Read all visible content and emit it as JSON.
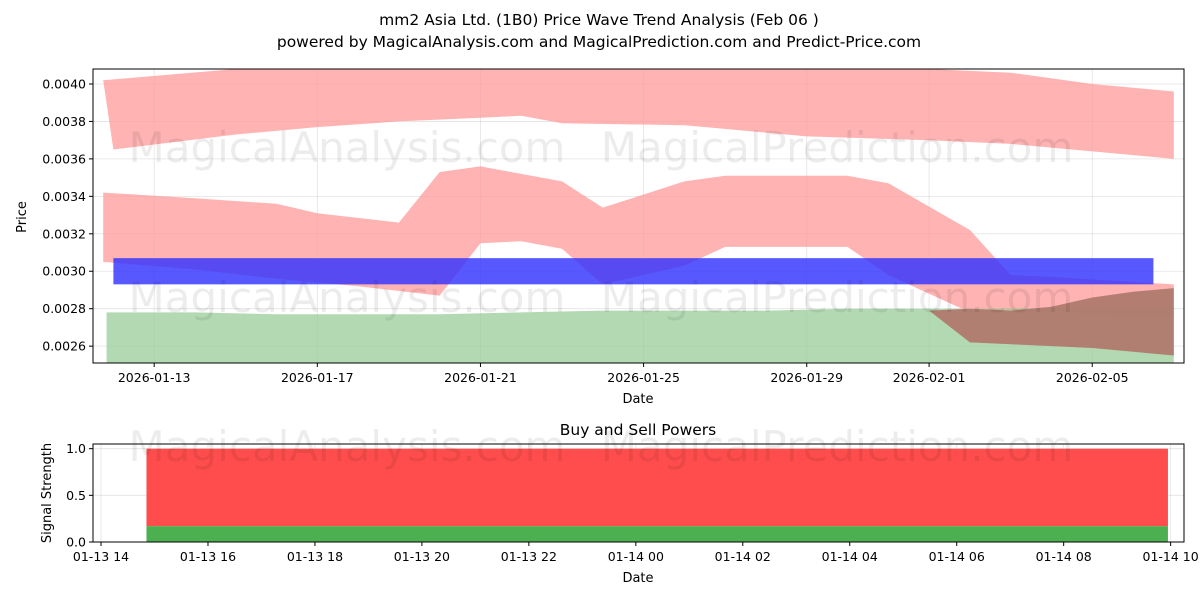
{
  "header": {
    "title": "mm2 Asia Ltd. (1B0) Price Wave Trend Analysis (Feb 06 )",
    "subtitle": "powered by MagicalAnalysis.com and MagicalPrediction.com and Predict-Price.com"
  },
  "watermarks": [
    "MagicalAnalysis.com",
    "MagicalPrediction.com"
  ],
  "chart_data": [
    {
      "type": "area",
      "xlabel": "Date",
      "ylabel": "Price",
      "x_is_date": true,
      "xlim": [
        "2026-01-11T12:00",
        "2026-02-07T06:00"
      ],
      "ylim": [
        0.00251,
        0.00408
      ],
      "grid": true,
      "y_ticks": [
        "0.0026",
        "0.0028",
        "0.0030",
        "0.0032",
        "0.0034",
        "0.0036",
        "0.0038",
        "0.0040"
      ],
      "x_ticks": [
        "2026-01-13",
        "2026-01-17",
        "2026-01-21",
        "2026-01-25",
        "2026-01-29",
        "2026-02-01",
        "2026-02-05"
      ],
      "bands": [
        {
          "color": "#ff9999",
          "upper": [
            [
              "2026-01-11T18:00",
              0.00402
            ],
            [
              "2026-01-15",
              0.00412
            ],
            [
              "2026-01-17",
              0.00415
            ],
            [
              "2026-01-19",
              0.00416
            ],
            [
              "2026-01-21",
              0.00418
            ],
            [
              "2026-01-23",
              0.00418
            ],
            [
              "2026-01-25",
              0.00416
            ],
            [
              "2026-01-29",
              0.00413
            ],
            [
              "2026-02-01",
              0.00409
            ],
            [
              "2026-02-03",
              0.00406
            ],
            [
              "2026-02-05",
              0.004
            ],
            [
              "2026-02-07",
              0.00396
            ]
          ],
          "lower": [
            [
              "2026-01-12",
              0.00365
            ],
            [
              "2026-01-15",
              0.00373
            ],
            [
              "2026-01-17",
              0.00377
            ],
            [
              "2026-01-19",
              0.0038
            ],
            [
              "2026-01-21",
              0.00382
            ],
            [
              "2026-01-22",
              0.00383
            ],
            [
              "2026-01-23",
              0.00379
            ],
            [
              "2026-01-26",
              0.00378
            ],
            [
              "2026-01-29",
              0.00372
            ],
            [
              "2026-02-01",
              0.0037
            ],
            [
              "2026-02-03",
              0.00368
            ],
            [
              "2026-02-06",
              0.00362
            ],
            [
              "2026-02-07",
              0.0036
            ]
          ]
        },
        {
          "color": "#ff9999",
          "upper": [
            [
              "2026-01-11T18:00",
              0.00342
            ],
            [
              "2026-01-14",
              0.00339
            ],
            [
              "2026-01-16",
              0.00336
            ],
            [
              "2026-01-17",
              0.00331
            ],
            [
              "2026-01-19",
              0.00326
            ],
            [
              "2026-01-20",
              0.00353
            ],
            [
              "2026-01-21",
              0.00356
            ],
            [
              "2026-01-22",
              0.00352
            ],
            [
              "2026-01-23",
              0.00348
            ],
            [
              "2026-01-24",
              0.00334
            ],
            [
              "2026-01-26",
              0.00348
            ],
            [
              "2026-01-27",
              0.00351
            ],
            [
              "2026-01-30",
              0.00351
            ],
            [
              "2026-01-31",
              0.00347
            ],
            [
              "2026-02-02",
              0.00322
            ],
            [
              "2026-02-03",
              0.00298
            ],
            [
              "2026-02-04",
              0.00297
            ],
            [
              "2026-02-07",
              0.00293
            ]
          ],
          "lower": [
            [
              "2026-01-11T18:00",
              0.00305
            ],
            [
              "2026-01-14",
              0.00301
            ],
            [
              "2026-01-16",
              0.00296
            ],
            [
              "2026-01-18",
              0.00292
            ],
            [
              "2026-01-20",
              0.00287
            ],
            [
              "2026-01-21",
              0.00315
            ],
            [
              "2026-01-22",
              0.00316
            ],
            [
              "2026-01-23",
              0.00312
            ],
            [
              "2026-01-24",
              0.00293
            ],
            [
              "2026-01-26",
              0.00303
            ],
            [
              "2026-01-27",
              0.00313
            ],
            [
              "2026-01-30",
              0.00313
            ],
            [
              "2026-01-31",
              0.00298
            ],
            [
              "2026-02-02",
              0.00278
            ],
            [
              "2026-02-03",
              0.00279
            ],
            [
              "2026-02-04",
              0.00278
            ],
            [
              "2026-02-07",
              0.00275
            ]
          ]
        },
        {
          "color": "#99cc99",
          "upper": [
            [
              "2026-01-11T20:00",
              0.00278
            ],
            [
              "2026-01-14",
              0.00278
            ],
            [
              "2026-01-16",
              0.00277
            ],
            [
              "2026-01-18",
              0.00277
            ],
            [
              "2026-01-20",
              0.00277
            ],
            [
              "2026-01-22",
              0.00278
            ],
            [
              "2026-01-24",
              0.00279
            ],
            [
              "2026-01-26",
              0.00279
            ],
            [
              "2026-01-28",
              0.00279
            ],
            [
              "2026-01-30",
              0.0028
            ],
            [
              "2026-02-01",
              0.0028
            ],
            [
              "2026-02-03",
              0.0028
            ],
            [
              "2026-02-05",
              0.00281
            ],
            [
              "2026-02-07",
              0.00281
            ]
          ],
          "lower": [
            [
              "2026-01-11T20:00",
              0.00251
            ],
            [
              "2026-02-03",
              0.00251
            ],
            [
              "2026-02-07",
              0.00251
            ]
          ]
        },
        {
          "color": "#b07a6e",
          "upper": [
            [
              "2026-02-01",
              0.00279
            ],
            [
              "2026-02-02",
              0.0028
            ],
            [
              "2026-02-03",
              0.00279
            ],
            [
              "2026-02-04",
              0.00281
            ],
            [
              "2026-02-05",
              0.00286
            ],
            [
              "2026-02-06",
              0.00289
            ],
            [
              "2026-02-07",
              0.00291
            ]
          ],
          "lower": [
            [
              "2026-02-01",
              0.00279
            ],
            [
              "2026-02-02",
              0.00262
            ],
            [
              "2026-02-03",
              0.00261
            ],
            [
              "2026-02-04",
              0.0026
            ],
            [
              "2026-02-05",
              0.00259
            ],
            [
              "2026-02-06",
              0.00257
            ],
            [
              "2026-02-07",
              0.00255
            ]
          ]
        }
      ],
      "rect": {
        "color": "#3333ff",
        "x0": "2026-01-12",
        "x1": "2026-02-06T12:00",
        "y0": 0.00293,
        "y1": 0.00307
      }
    },
    {
      "type": "bar",
      "title": "Buy and Sell Powers",
      "xlabel": "Date",
      "ylabel": "Signal Strength",
      "xlim_hours": [
        13.85,
        34.25
      ],
      "ylim": [
        0,
        1.05
      ],
      "grid": true,
      "x_ticks": [
        "01-13 14",
        "01-13 16",
        "01-13 18",
        "01-13 20",
        "01-13 22",
        "01-14 00",
        "01-14 02",
        "01-14 04",
        "01-14 06",
        "01-14 08",
        "01-14 10"
      ],
      "y_ticks": [
        "0.0",
        "0.5",
        "1.0"
      ],
      "span_hours": [
        14.85,
        33.95
      ],
      "series": [
        {
          "value": 0.17,
          "color": "#4caf50"
        },
        {
          "value": 1.0,
          "color": "#ff4d4d"
        }
      ]
    }
  ]
}
